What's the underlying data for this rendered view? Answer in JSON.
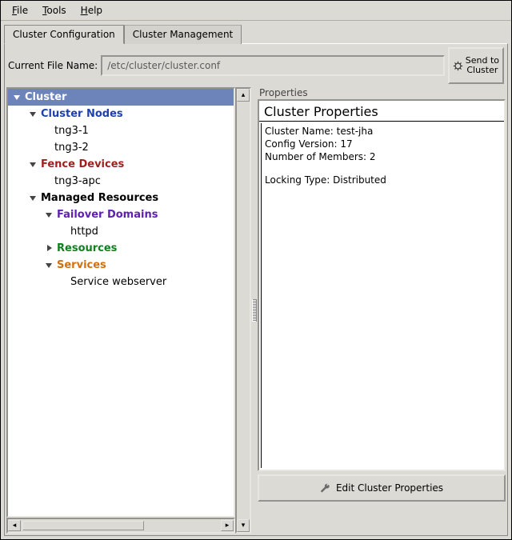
{
  "menu": {
    "file": "File",
    "tools": "Tools",
    "help": "Help"
  },
  "tabs": {
    "config": "Cluster Configuration",
    "mgmt": "Cluster Management"
  },
  "file_row": {
    "label": "Current File Name:",
    "value": "/etc/cluster/cluster.conf",
    "send1": "Send to",
    "send2": "Cluster"
  },
  "tree": {
    "root": "Cluster",
    "nodes": {
      "label": "Cluster Nodes",
      "items": [
        "tng3-1",
        "tng3-2"
      ]
    },
    "fence": {
      "label": "Fence Devices",
      "items": [
        "tng3-apc"
      ]
    },
    "managed": {
      "label": "Managed Resources",
      "failover": {
        "label": "Failover Domains",
        "items": [
          "httpd"
        ]
      },
      "resources": {
        "label": "Resources"
      },
      "services": {
        "label": "Services",
        "items": [
          "Service webserver"
        ]
      }
    }
  },
  "props": {
    "section": "Properties",
    "title": "Cluster Properties",
    "rows": {
      "name_l": "Cluster Name: ",
      "name_v": "test-jha",
      "ver_l": "Config Version: ",
      "ver_v": "17",
      "mem_l": "Number of Members: ",
      "mem_v": "2",
      "lock_l": "Locking Type: ",
      "lock_v": "Distributed"
    },
    "edit": "Edit Cluster Properties"
  },
  "colors": {
    "selection": "#6d84bb"
  }
}
